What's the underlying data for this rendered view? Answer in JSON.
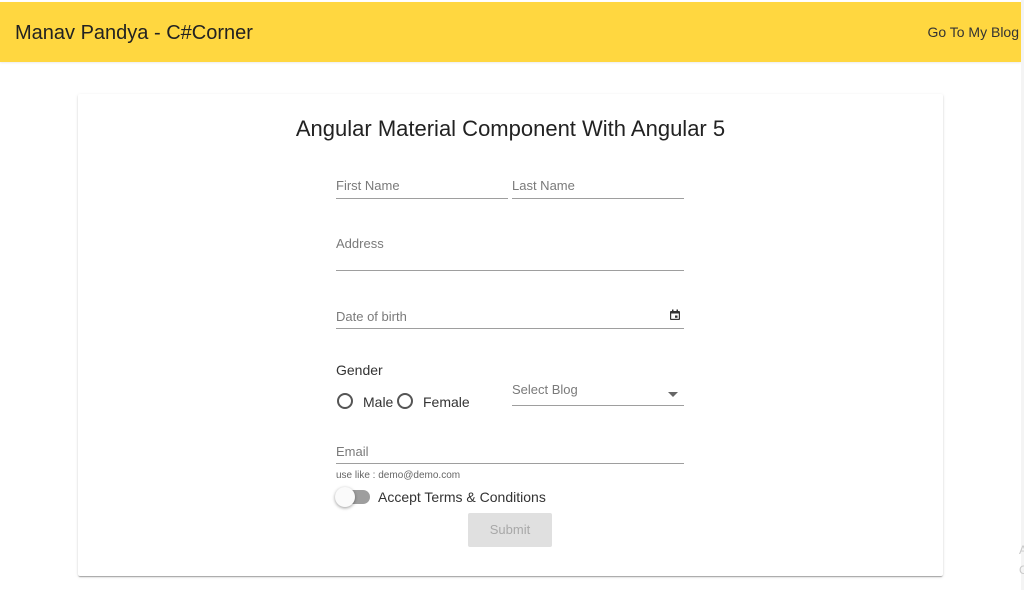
{
  "header": {
    "app_title": "Manav Pandya - C#Corner",
    "blog_link": "Go To My Blog",
    "background_color": "#ffd740"
  },
  "form": {
    "title": "Angular Material Component With Angular 5",
    "first_name_placeholder": "First Name",
    "last_name_placeholder": "Last Name",
    "address_placeholder": "Address",
    "dob_placeholder": "Date of birth",
    "dob_icon": "calendar-icon",
    "gender_label": "Gender",
    "gender_options": [
      "Male",
      "Female"
    ],
    "select_blog_placeholder": "Select Blog",
    "email_placeholder": "Email",
    "email_hint": "use like : demo@demo.com",
    "terms_label": "Accept Terms & Conditions",
    "terms_checked": false,
    "submit_label": "Submit",
    "submit_disabled": true
  }
}
